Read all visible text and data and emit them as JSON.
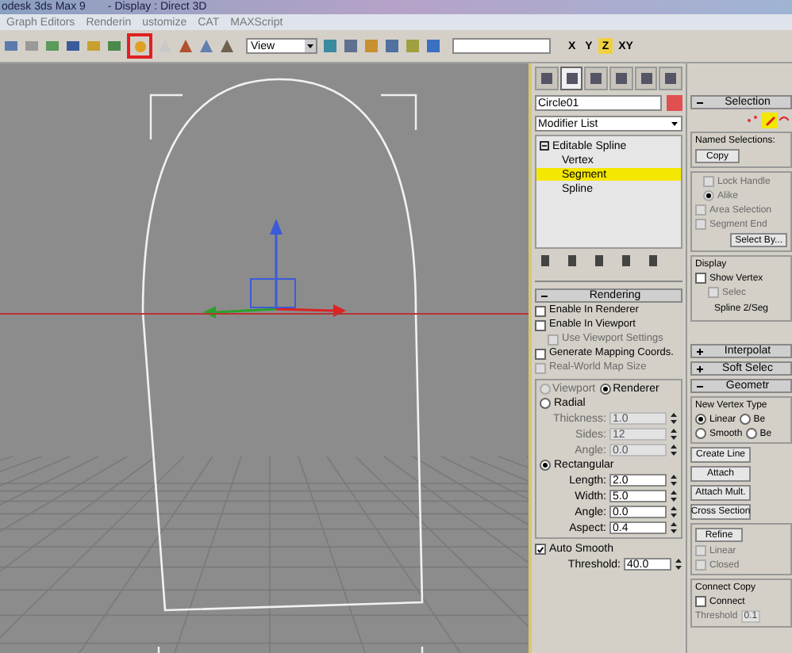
{
  "title_bar": {
    "title": "odesk 3ds Max 9",
    "subtitle": "- Display : Direct 3D"
  },
  "menu": [
    "Graph Editors",
    "Renderin",
    "ustomize",
    "CAT",
    "MAXScript"
  ],
  "toolbar": {
    "view_dropdown": "View",
    "axes": [
      {
        "label": "X",
        "selected": false
      },
      {
        "label": "Y",
        "selected": false
      },
      {
        "label": "Z",
        "selected": true
      },
      {
        "label": "XY",
        "selected": false
      }
    ]
  },
  "command_panel": {
    "tabs": [
      {
        "selected": false
      },
      {
        "selected": true
      },
      {
        "selected": false
      },
      {
        "selected": false
      },
      {
        "selected": false
      },
      {
        "selected": false
      }
    ],
    "object_name": "Circle01",
    "modifier_list": "Modifier List",
    "stack": [
      {
        "label": "Editable Spline",
        "selected": false,
        "children": [
          {
            "label": "Vertex",
            "selected": false
          },
          {
            "label": "Segment",
            "selected": true
          },
          {
            "label": "Spline",
            "selected": false
          }
        ]
      }
    ],
    "rendering": {
      "title": "Rendering",
      "options": [
        {
          "label": "Enable In Renderer",
          "checked": false,
          "disabled": false
        },
        {
          "label": "Enable In Viewport",
          "checked": false,
          "disabled": false
        },
        {
          "label": "Use Viewport Settings",
          "checked": false,
          "disabled": true
        },
        {
          "label": "Generate Mapping Coords.",
          "checked": false,
          "disabled": false
        },
        {
          "label": "Real-World Map Size",
          "checked": false,
          "disabled": true
        }
      ],
      "mode": [
        {
          "label": "Viewport",
          "selected": false,
          "disabled": true
        },
        {
          "label": "Renderer",
          "selected": true,
          "disabled": false
        }
      ],
      "radial": {
        "label": "Radial",
        "selected": false,
        "fields": [
          {
            "label": "Thickness:",
            "value": "1.0"
          },
          {
            "label": "Sides:",
            "value": "12"
          },
          {
            "label": "Angle:",
            "value": "0.0"
          }
        ]
      },
      "rectangular": {
        "label": "Rectangular",
        "selected": true,
        "fields": [
          {
            "label": "Length:",
            "value": "2.0"
          },
          {
            "label": "Width:",
            "value": "5.0"
          },
          {
            "label": "Angle:",
            "value": "0.0"
          },
          {
            "label": "Aspect:",
            "value": "0.4"
          }
        ]
      },
      "auto_smooth": {
        "label": "Auto Smooth",
        "checked": true
      },
      "threshold": {
        "label": "Threshold:",
        "value": "40.0"
      }
    }
  },
  "right_panel": {
    "selection_title": "Selection",
    "named_selections": "Named Selections:",
    "copy": "Copy",
    "options": [
      {
        "label": "Lock Handle",
        "checked": false
      },
      {
        "label": "Area Selection",
        "checked": false
      },
      {
        "label": "Segment End",
        "checked": false
      }
    ],
    "alike": {
      "label": "Alike",
      "selected": true
    },
    "select_by": "Select By...",
    "display_title": "Display",
    "show_vertex": {
      "label": "Show Vertex",
      "checked": false
    },
    "selec": {
      "label": "Selec",
      "checked": false
    },
    "status": "Spline 2/Seg",
    "rollouts": [
      {
        "title": "Interpolat",
        "expanded": false
      },
      {
        "title": "Soft Selec",
        "expanded": false
      },
      {
        "title": "Geometr",
        "expanded": true
      }
    ],
    "new_vertex_type": "New Vertex Type",
    "vertex_types": [
      {
        "label": "Linear",
        "selected": true,
        "alt": {
          "label": "Be",
          "selected": false
        }
      },
      {
        "label": "Smooth",
        "selected": false,
        "alt": {
          "label": "Be",
          "selected": false
        }
      }
    ],
    "buttons": [
      "Create Line",
      "Attach",
      "Attach Mult.",
      "Cross Section"
    ],
    "refine": "Refine",
    "refine_options": [
      {
        "label": "Linear",
        "checked": false
      },
      {
        "label": "Closed",
        "checked": false
      }
    ],
    "connect_copy": "Connect Copy",
    "connect": {
      "label": "Connect",
      "checked": false
    },
    "threshold": {
      "label": "Threshold",
      "value": "0.1"
    }
  }
}
